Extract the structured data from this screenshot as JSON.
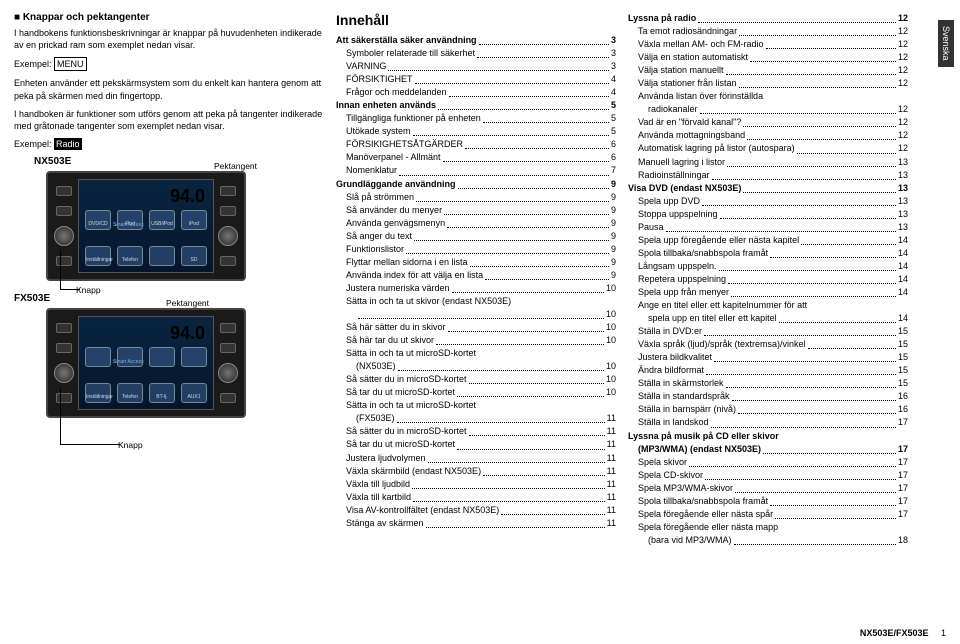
{
  "tab": "Svenska",
  "left": {
    "heading": "Knappar och pektangenter",
    "p1": "I handbokens funktionsbeskrivningar är knappar på huvudenheten indikerade av en prickad ram som exemplet nedan visar.",
    "ex1_label": "Exempel:",
    "ex1_box": "MENU",
    "p2": "Enheten använder ett pekskärmsystem som du enkelt kan hantera genom att peka på skärmen med din fingertopp.",
    "p3": "I handboken är funktioner som utförs genom att peka på tangenter indikerade med gråtonade tangenter som exemplet nedan visar.",
    "ex2_label": "Exempel:",
    "ex2_box": "Radio",
    "model1": "NX503E",
    "model2": "FX503E",
    "callout_pek": "Pektangent",
    "callout_knapp": "Knapp",
    "freq": "94.0",
    "sicon1": "Inställningar",
    "sicon2": "Telefon",
    "sicon3": "",
    "sicon4": "SD",
    "sicon1b": "Inställningar",
    "sicon2b": "Telefon",
    "sicon3b": "BT-lj.",
    "sicon4b": "AUX1",
    "ticon1": "DVD/CD",
    "ticon2": "iPod",
    "ticon3": "USB/iPod",
    "ticon4": "iPod",
    "sm": "Smart Access"
  },
  "toc_heading": "Innehåll",
  "toc_mid": [
    {
      "t": "Att säkerställa säker användning",
      "p": "3",
      "b": 1,
      "i": 0
    },
    {
      "t": "Symboler relaterade till säkerhet",
      "p": "3",
      "i": 1
    },
    {
      "t": "VARNING",
      "p": "3",
      "i": 1
    },
    {
      "t": "FÖRSIKTIGHET",
      "p": "4",
      "i": 1
    },
    {
      "t": "Frågor och meddelanden",
      "p": "4",
      "i": 1
    },
    {
      "t": "Innan enheten används",
      "p": "5",
      "b": 1,
      "i": 0
    },
    {
      "t": "Tillgängliga funktioner på enheten",
      "p": "5",
      "i": 1
    },
    {
      "t": "Utökade system",
      "p": "5",
      "i": 1
    },
    {
      "t": "FÖRSIKIGHETSÅTGÄRDER",
      "p": "6",
      "i": 1
    },
    {
      "t": "Manöverpanel - Allmänt",
      "p": "6",
      "i": 1
    },
    {
      "t": "Nomenklatur",
      "p": "7",
      "i": 1
    },
    {
      "t": "Grundläggande användning",
      "p": "9",
      "b": 1,
      "i": 0
    },
    {
      "t": "Slå på strömmen",
      "p": "9",
      "i": 1
    },
    {
      "t": "Så använder du menyer",
      "p": "9",
      "i": 1
    },
    {
      "t": "Använda genvägsmenyn",
      "p": "9",
      "i": 1
    },
    {
      "t": "Så anger du text",
      "p": "9",
      "i": 1
    },
    {
      "t": "Funktionslistor",
      "p": "9",
      "i": 1
    },
    {
      "t": "Flyttar mellan sidorna i en lista",
      "p": "9",
      "i": 1
    },
    {
      "t": "Använda index för att välja en lista",
      "p": "9",
      "i": 1
    },
    {
      "t": "Justera numeriska värden",
      "p": "10",
      "i": 1
    },
    {
      "t": "Sätta in och ta ut skivor (endast NX503E)",
      "p": "",
      "i": 1
    },
    {
      "t": "",
      "p": "10",
      "i": 2
    },
    {
      "t": "Så här sätter du in skivor",
      "p": "10",
      "i": 1
    },
    {
      "t": "Så här tar du ut skivor",
      "p": "10",
      "i": 1
    },
    {
      "t": "Sätta in och ta ut microSD-kortet",
      "p": "",
      "i": 1
    },
    {
      "t": "(NX503E)",
      "p": "10",
      "i": 2
    },
    {
      "t": "Så sätter du in microSD-kortet",
      "p": "10",
      "i": 1
    },
    {
      "t": "Så tar du ut microSD-kortet",
      "p": "10",
      "i": 1
    },
    {
      "t": "Sätta in och ta ut microSD-kortet",
      "p": "",
      "i": 1
    },
    {
      "t": "(FX503E)",
      "p": "11",
      "i": 2
    },
    {
      "t": "Så sätter du in microSD-kortet",
      "p": "11",
      "i": 1
    },
    {
      "t": "Så tar du ut microSD-kortet",
      "p": "11",
      "i": 1
    },
    {
      "t": "Justera ljudvolymen",
      "p": "11",
      "i": 1
    },
    {
      "t": "Växla skärmbild (endast NX503E)",
      "p": "11",
      "i": 1
    },
    {
      "t": "Växla till ljudbild",
      "p": "11",
      "i": 1
    },
    {
      "t": "Växla till kartbild",
      "p": "11",
      "i": 1
    },
    {
      "t": "Visa AV-kontrollfältet (endast NX503E)",
      "p": "11",
      "i": 1
    },
    {
      "t": "Stänga av skärmen",
      "p": "11",
      "i": 1
    }
  ],
  "toc_right": [
    {
      "t": "Lyssna på radio",
      "p": "12",
      "b": 1,
      "i": 0
    },
    {
      "t": "Ta emot radiosändningar",
      "p": "12",
      "i": 1
    },
    {
      "t": "Växla mellan AM- och FM-radio",
      "p": "12",
      "i": 1
    },
    {
      "t": "Välja en station automatiskt",
      "p": "12",
      "i": 1
    },
    {
      "t": "Välja station manuellt",
      "p": "12",
      "i": 1
    },
    {
      "t": "Välja stationer från listan",
      "p": "12",
      "i": 1
    },
    {
      "t": "Använda listan över förinställda",
      "p": "",
      "i": 1
    },
    {
      "t": "radiokanaler",
      "p": "12",
      "i": 2
    },
    {
      "t": "Vad är en \"förvald kanal\"?",
      "p": "12",
      "i": 1
    },
    {
      "t": "Använda mottagningsband",
      "p": "12",
      "i": 1
    },
    {
      "t": "Automatisk lagring på listor (autospara)",
      "p": "12",
      "i": 1
    },
    {
      "t": "Manuell lagring i listor",
      "p": "13",
      "i": 1
    },
    {
      "t": "Radioinställningar",
      "p": "13",
      "i": 1
    },
    {
      "t": "Visa DVD (endast NX503E)",
      "p": "13",
      "b": 1,
      "i": 0
    },
    {
      "t": "Spela upp DVD",
      "p": "13",
      "i": 1
    },
    {
      "t": "Stoppa uppspelning",
      "p": "13",
      "i": 1
    },
    {
      "t": "Pausa",
      "p": "13",
      "i": 1
    },
    {
      "t": "Spela upp föregående eller nästa kapitel",
      "p": "14",
      "i": 1
    },
    {
      "t": "Spola tillbaka/snabbspola framåt",
      "p": "14",
      "i": 1
    },
    {
      "t": "Långsam uppspeln.",
      "p": "14",
      "i": 1
    },
    {
      "t": "Repetera uppspelning",
      "p": "14",
      "i": 1
    },
    {
      "t": "Spela upp från menyer",
      "p": "14",
      "i": 1
    },
    {
      "t": "Ange en titel eller ett kapitelnummer för att",
      "p": "",
      "i": 1
    },
    {
      "t": "spela upp en titel eller ett kapitel",
      "p": "14",
      "i": 2
    },
    {
      "t": "Ställa in DVD:er",
      "p": "15",
      "i": 1
    },
    {
      "t": "Växla språk (ljud)/språk (textremsa)/vinkel",
      "p": "15",
      "i": 1
    },
    {
      "t": "Justera bildkvalitet",
      "p": "15",
      "i": 1
    },
    {
      "t": "Ändra bildformat",
      "p": "15",
      "i": 1
    },
    {
      "t": "Ställa in skärmstorlek",
      "p": "15",
      "i": 1
    },
    {
      "t": "Ställa in standardspråk",
      "p": "16",
      "i": 1
    },
    {
      "t": "Ställa in barnspärr (nivå)",
      "p": "16",
      "i": 1
    },
    {
      "t": "Ställa in landskod",
      "p": "17",
      "i": 1
    },
    {
      "t": "Lyssna på musik på CD eller skivor",
      "p": "",
      "b": 1,
      "i": 0
    },
    {
      "t": "(MP3/WMA) (endast NX503E)",
      "p": "17",
      "b": 1,
      "i": 1
    },
    {
      "t": "Spela skivor",
      "p": "17",
      "i": 1
    },
    {
      "t": "Spela CD-skivor",
      "p": "17",
      "i": 1
    },
    {
      "t": "Spela MP3/WMA-skivor",
      "p": "17",
      "i": 1
    },
    {
      "t": "Spola tillbaka/snabbspola framåt",
      "p": "17",
      "i": 1
    },
    {
      "t": "Spela föregående eller nästa spår",
      "p": "17",
      "i": 1
    },
    {
      "t": "Spela föregående eller nästa mapp",
      "p": "",
      "i": 1
    },
    {
      "t": "(bara vid MP3/WMA)",
      "p": "18",
      "i": 2
    }
  ],
  "footer_model": "NX503E/FX503E",
  "footer_page": "1"
}
